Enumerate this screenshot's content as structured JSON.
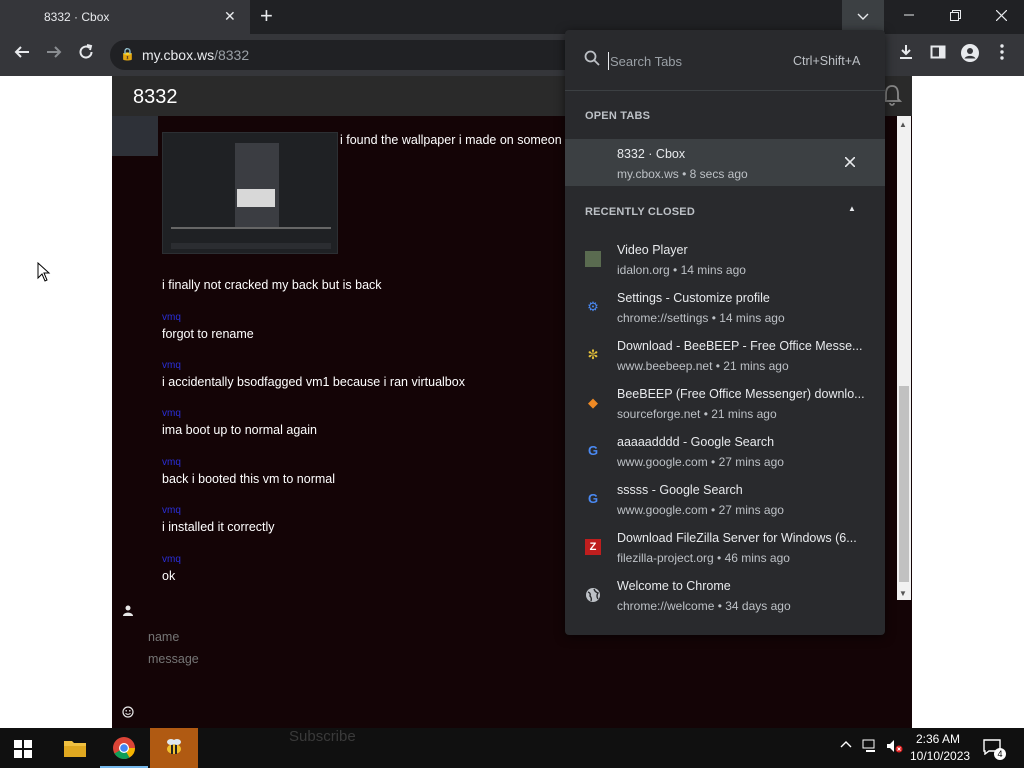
{
  "browser": {
    "tab_title": "8332 · Cbox",
    "tab_close": "✕",
    "new_tab": "+",
    "omnibox_host": "my.cbox.ws",
    "omnibox_path": "/8332"
  },
  "page": {
    "cbox_title": "8332",
    "messages": [
      {
        "user": "",
        "text": "i found the wallpaper i made on someon"
      },
      {
        "user": "",
        "text": "i finally not cracked my back but is back"
      },
      {
        "user": "vmq",
        "text": "forgot to rename"
      },
      {
        "user": "vmq",
        "text": "i accidentally bsodfagged vm1 because i ran virtualbox"
      },
      {
        "user": "vmq",
        "text": "ima boot up to normal again"
      },
      {
        "user": "vmq",
        "text": "back i booted this vm to normal"
      },
      {
        "user": "vmq",
        "text": "i installed it correctly"
      },
      {
        "user": "vmq",
        "text": "ok"
      }
    ],
    "name_placeholder": "name",
    "message_placeholder": "message"
  },
  "tab_search": {
    "placeholder": "Search Tabs",
    "shortcut": "Ctrl+Shift+A",
    "open_tabs_heading": "OPEN TABS",
    "open_tabs": [
      {
        "title": "8332 · Cbox",
        "sub": "my.cbox.ws • 8 secs ago"
      }
    ],
    "recently_closed_heading": "RECENTLY CLOSED",
    "recently_closed": [
      {
        "title": "Video Player",
        "sub": "idalon.org • 14 mins ago",
        "icon": "video-player-favicon"
      },
      {
        "title": "Settings - Customize profile",
        "sub": "chrome://settings • 14 mins ago",
        "icon": "gear-icon"
      },
      {
        "title": "Download - BeeBEEP - Free Office Messe...",
        "sub": "www.beebeep.net • 21 mins ago",
        "icon": "bee-icon"
      },
      {
        "title": "BeeBEEP (Free Office Messenger) downlo...",
        "sub": "sourceforge.net • 21 mins ago",
        "icon": "sourceforge-icon"
      },
      {
        "title": "aaaaadddd - Google Search",
        "sub": "www.google.com • 27 mins ago",
        "icon": "google-icon"
      },
      {
        "title": "sssss - Google Search",
        "sub": "www.google.com • 27 mins ago",
        "icon": "google-icon"
      },
      {
        "title": "Download FileZilla Server for Windows (6...",
        "sub": "filezilla-project.org • 46 mins ago",
        "icon": "filezilla-icon"
      },
      {
        "title": "Welcome to Chrome",
        "sub": "chrome://welcome • 34 days ago",
        "icon": "globe-icon"
      }
    ]
  },
  "taskbar": {
    "time": "2:36 AM",
    "date": "10/10/2023",
    "notifications": "4"
  },
  "colors": {
    "popup_bg": "#292a2d",
    "selected_row": "#3c4043",
    "page_bg": "#140406",
    "username": "#2a2fd8"
  }
}
